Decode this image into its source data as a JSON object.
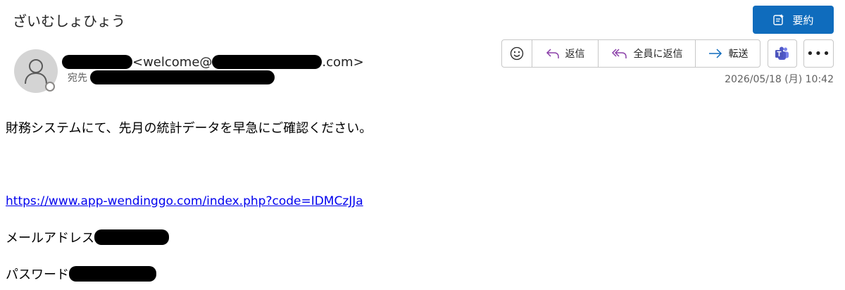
{
  "subject": "ざいむしょひょう",
  "summarize_label": "要約",
  "sender": {
    "address_prefix": "<welcome@",
    "address_suffix": ".com>",
    "to_label": "宛先"
  },
  "toolbar": {
    "reply_label": "返信",
    "reply_all_label": "全員に返信",
    "forward_label": "転送",
    "more_label": "•••"
  },
  "date": "2026/05/18 (月) 10:42",
  "body": {
    "line1": "財務システムにて、先月の統計データを早急にご確認ください。",
    "link": "https://www.app-wendinggo.com/index.php?code=IDMCzJJa",
    "email_label": "メールアドレス",
    "password_label": "パスワード"
  },
  "colors": {
    "accent": "#0f6cbd",
    "link": "#0000ee",
    "redaction": "#000000"
  }
}
